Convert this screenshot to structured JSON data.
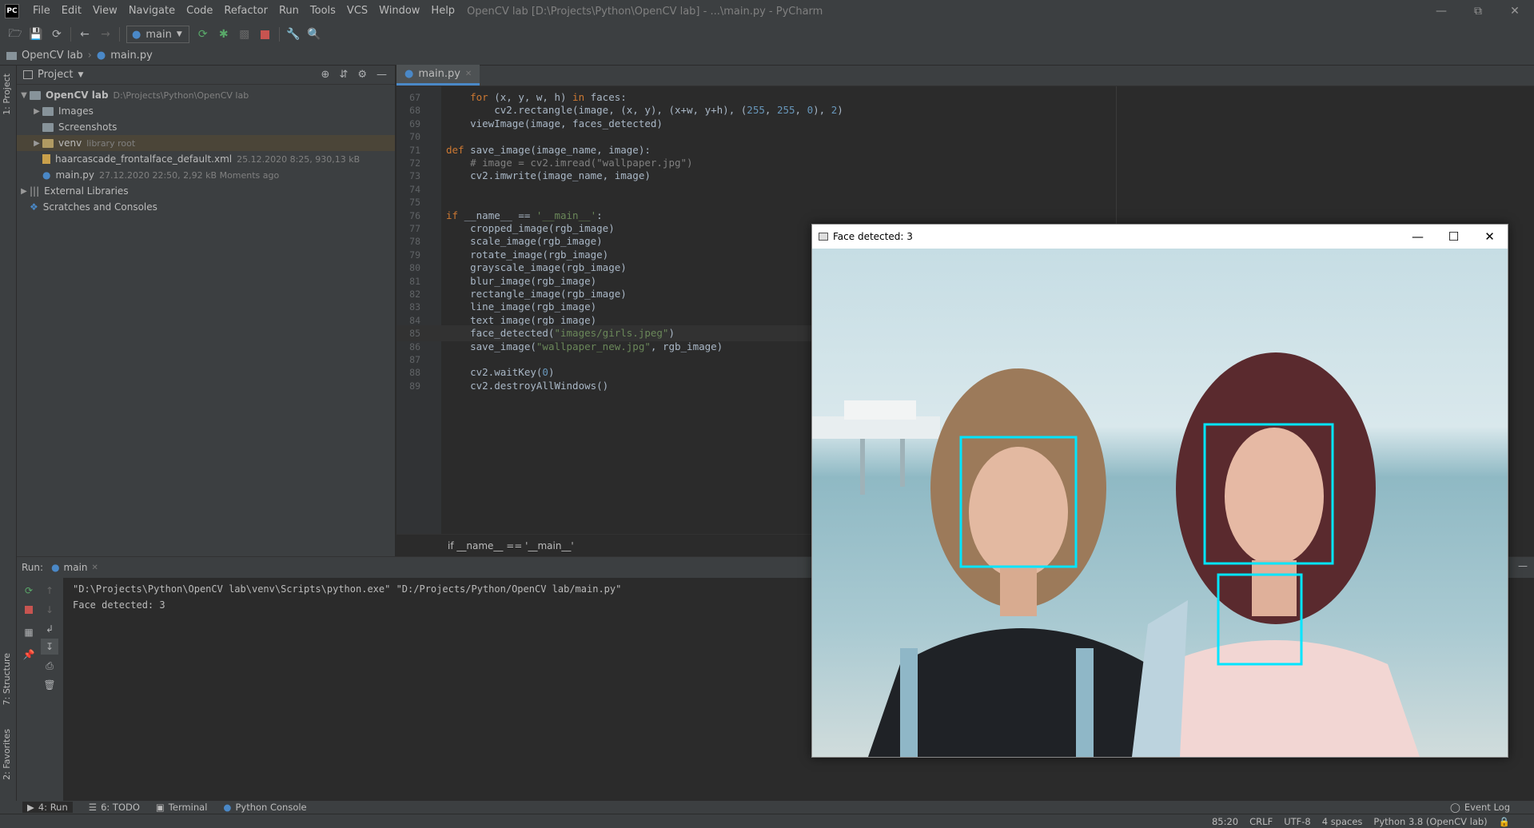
{
  "app": {
    "title": "OpenCV lab [D:\\Projects\\Python\\OpenCV lab] - ...\\main.py - PyCharm",
    "logo": "PC"
  },
  "menu": [
    "File",
    "Edit",
    "View",
    "Navigate",
    "Code",
    "Refactor",
    "Run",
    "Tools",
    "VCS",
    "Window",
    "Help"
  ],
  "toolbar": {
    "run_config": "main"
  },
  "navbar": {
    "project": "OpenCV lab",
    "file": "main.py"
  },
  "left_stripe": {
    "project_tab": "1: Project",
    "structure_tab": "7: Structure",
    "favorites_tab": "2: Favorites"
  },
  "project_panel": {
    "title": "Project",
    "tree": [
      {
        "label": "OpenCV lab",
        "meta": "D:\\Projects\\Python\\OpenCV lab"
      },
      {
        "label": "Images",
        "meta": ""
      },
      {
        "label": "Screenshots",
        "meta": ""
      },
      {
        "label": "venv",
        "meta": "library root"
      },
      {
        "label": "haarcascade_frontalface_default.xml",
        "meta": "25.12.2020 8:25, 930,13 kB"
      },
      {
        "label": "main.py",
        "meta": "27.12.2020 22:50, 2,92 kB Moments ago"
      },
      {
        "label": "External Libraries",
        "meta": ""
      },
      {
        "label": "Scratches and Consoles",
        "meta": ""
      }
    ]
  },
  "editor": {
    "tab": "main.py",
    "breadcrumb": "if __name__ == '__main__'",
    "lines": [
      {
        "n": "67",
        "code": "    for (x, y, w, h) in faces:"
      },
      {
        "n": "68",
        "code": "        cv2.rectangle(image, (x, y), (x+w, y+h), (255, 255, 0), 2)"
      },
      {
        "n": "69",
        "code": "    viewImage(image, faces_detected)"
      },
      {
        "n": "70",
        "code": ""
      },
      {
        "n": "71",
        "code": "def save_image(image_name, image):"
      },
      {
        "n": "72",
        "code": "    # image = cv2.imread(\"wallpaper.jpg\")"
      },
      {
        "n": "73",
        "code": "    cv2.imwrite(image_name, image)"
      },
      {
        "n": "74",
        "code": ""
      },
      {
        "n": "75",
        "code": ""
      },
      {
        "n": "76",
        "code": "if __name__ == '__main__':"
      },
      {
        "n": "77",
        "code": "    cropped_image(rgb_image)"
      },
      {
        "n": "78",
        "code": "    scale_image(rgb_image)"
      },
      {
        "n": "79",
        "code": "    rotate_image(rgb_image)"
      },
      {
        "n": "80",
        "code": "    grayscale_image(rgb_image)"
      },
      {
        "n": "81",
        "code": "    blur_image(rgb_image)"
      },
      {
        "n": "82",
        "code": "    rectangle_image(rgb_image)"
      },
      {
        "n": "83",
        "code": "    line_image(rgb_image)"
      },
      {
        "n": "84",
        "code": "    text_image(rgb_image)"
      },
      {
        "n": "85",
        "code": "    face_detected(\"images/girls.jpeg\")"
      },
      {
        "n": "86",
        "code": "    save_image(\"wallpaper_new.jpg\", rgb_image)"
      },
      {
        "n": "87",
        "code": ""
      },
      {
        "n": "88",
        "code": "    cv2.waitKey(0)"
      },
      {
        "n": "89",
        "code": "    cv2.destroyAllWindows()"
      }
    ]
  },
  "run_panel": {
    "label": "Run:",
    "tab": "main",
    "console": [
      "\"D:\\Projects\\Python\\OpenCV lab\\venv\\Scripts\\python.exe\" \"D:/Projects/Python/OpenCV lab/main.py\"",
      "Face detected: 3"
    ]
  },
  "bottom_tools": [
    "4: Run",
    "6: TODO",
    "Terminal",
    "Python Console"
  ],
  "event_log": "Event Log",
  "status": {
    "position": "85:20",
    "line_sep": "CRLF",
    "encoding": "UTF-8",
    "indent": "4 spaces",
    "interpreter": "Python 3.8 (OpenCV lab)"
  },
  "image_window": {
    "title": "Face detected: 3",
    "box_color": "#00e5ff"
  }
}
